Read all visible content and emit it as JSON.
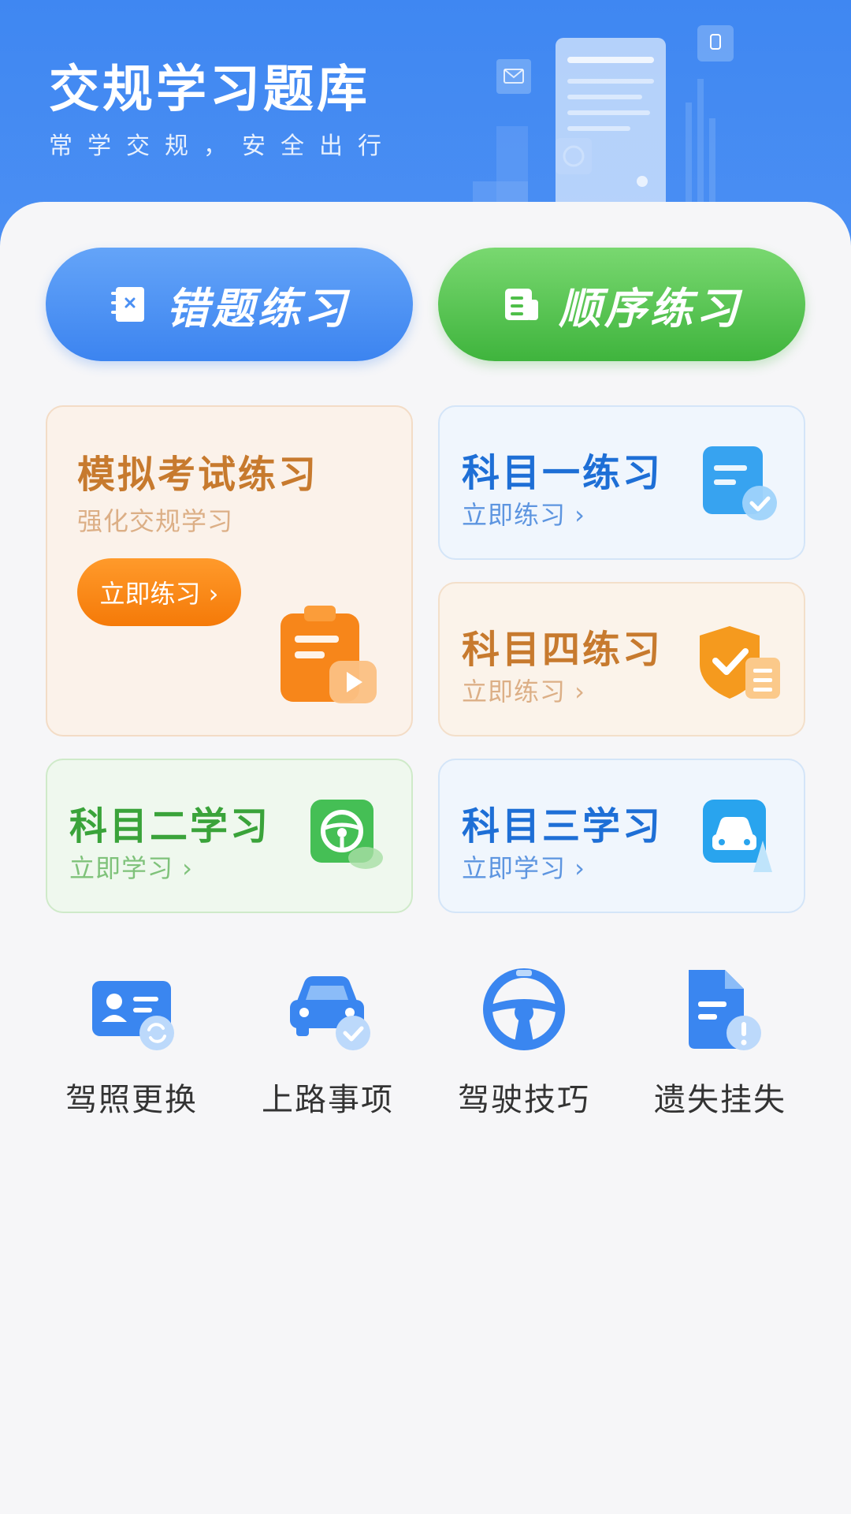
{
  "header": {
    "title": "交规学习题库",
    "subtitle": "常学交规，安全出行"
  },
  "actions": {
    "wrong_label": "错题练习",
    "sequence_label": "顺序练习"
  },
  "cards": {
    "mock": {
      "title": "模拟考试练习",
      "subtitle": "强化交规学习",
      "cta": "立即练习 ›"
    },
    "subject1": {
      "title": "科目一练习",
      "cta": "立即练习 ›"
    },
    "subject4": {
      "title": "科目四练习",
      "cta": "立即练习 ›"
    },
    "subject2": {
      "title": "科目二学习",
      "cta": "立即学习 ›"
    },
    "subject3": {
      "title": "科目三学习",
      "cta": "立即学习 ›"
    }
  },
  "tools": [
    {
      "label": "驾照更换",
      "icon": "license-renew-icon"
    },
    {
      "label": "上路事项",
      "icon": "car-check-icon"
    },
    {
      "label": "驾驶技巧",
      "icon": "steering-wheel-icon"
    },
    {
      "label": "遗失挂失",
      "icon": "document-alert-icon"
    }
  ],
  "colors": {
    "primary": "#3f87f2",
    "green": "#3fb43d",
    "orange": "#f57a08",
    "subject_blue": "#1e6fd6",
    "subject_orange": "#c77a2e",
    "subject_green": "#3aa33a"
  }
}
